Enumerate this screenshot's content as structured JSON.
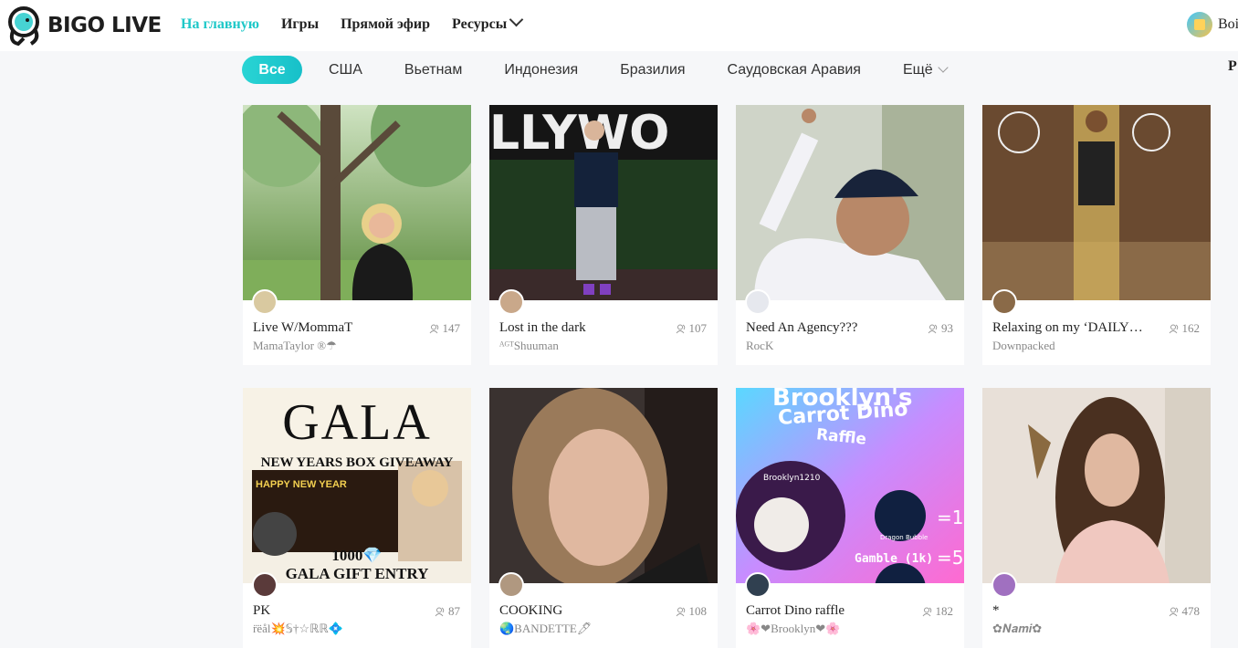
{
  "header": {
    "logo_text": "BIGO LIVE",
    "nav": [
      {
        "label": "На главную",
        "active": true
      },
      {
        "label": "Игры"
      },
      {
        "label": "Прямой эфир"
      },
      {
        "label": "Ресурсы"
      }
    ],
    "user_name": "Boi"
  },
  "tabs": [
    {
      "label": "Все",
      "active": true
    },
    {
      "label": "США"
    },
    {
      "label": "Вьетнам"
    },
    {
      "label": "Индонезия"
    },
    {
      "label": "Бразилия"
    },
    {
      "label": "Саудовская Аравия"
    },
    {
      "label": "Ещё"
    }
  ],
  "side_letter": "P",
  "streams": [
    {
      "title": "Live W/MommaT",
      "viewers": "147",
      "host": "MamaTaylor ®☂"
    },
    {
      "title": "Lost in the dark",
      "viewers": "107",
      "host": "ᴬᴳᵀShuuman"
    },
    {
      "title": "Need An Agency???",
      "viewers": "93",
      "host": "RocK ✉⃝"
    },
    {
      "title": "Relaxing on my ‘DAILY…",
      "viewers": "162",
      "host": "Downpacked"
    },
    {
      "title": "PK",
      "viewers": "87",
      "host": "r̈ëål💥𝕊†☆ℝℝ💠"
    },
    {
      "title": "COOKING",
      "viewers": "108",
      "host": "🌏BANDETTE🖊"
    },
    {
      "title": "Carrot Dino raffle",
      "viewers": "182",
      "host": "🌸❤Brooklyn❤🌸"
    },
    {
      "title": "*",
      "viewers": "478",
      "host": "✿𝑵𝒂𝒎𝒊✿"
    }
  ],
  "thumb_text": {
    "hollywood": "LLYWO",
    "gala": "GALA",
    "gala_sub": "NEW YEARS BOX GIVEAWAY",
    "gala_happy": "HAPPY NEW YEAR",
    "gala_entry": "1000💎",
    "gala_gift": "GALA GIFT ENTRY",
    "dino_top": "Brooklyn's",
    "dino_title": "Carrot Dino",
    "dino_raffle": "Raffle",
    "dino_user": "Brooklyn1210",
    "dino_bubble": "Dragon Bubble",
    "dino_eq1": "=1",
    "dino_gamble": "Gamble (1k)",
    "dino_eq5": "=5"
  },
  "colors": {
    "accent": "#1ec8c8",
    "text": "#222222",
    "muted": "#888888"
  }
}
